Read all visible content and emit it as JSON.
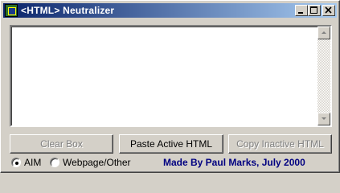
{
  "window": {
    "title": "<HTML> Neutralizer",
    "icon": "app-icon",
    "controls": [
      "minimize-icon",
      "maximize-icon",
      "close-icon"
    ]
  },
  "editor": {
    "value": ""
  },
  "buttons": {
    "clear": {
      "label": "Clear Box",
      "enabled": false
    },
    "paste": {
      "label": "Paste Active HTML",
      "enabled": true
    },
    "copy": {
      "label": "Copy Inactive HTML",
      "enabled": false
    }
  },
  "mode": {
    "options": [
      {
        "label": "AIM",
        "selected": true
      },
      {
        "label": "Webpage/Other",
        "selected": false
      }
    ]
  },
  "credit": "Made By Paul Marks, July 2000",
  "colors": {
    "titlebar_start": "#0a246a",
    "titlebar_end": "#a6caf0",
    "credit_text": "#000080",
    "face": "#d4d0c8"
  }
}
